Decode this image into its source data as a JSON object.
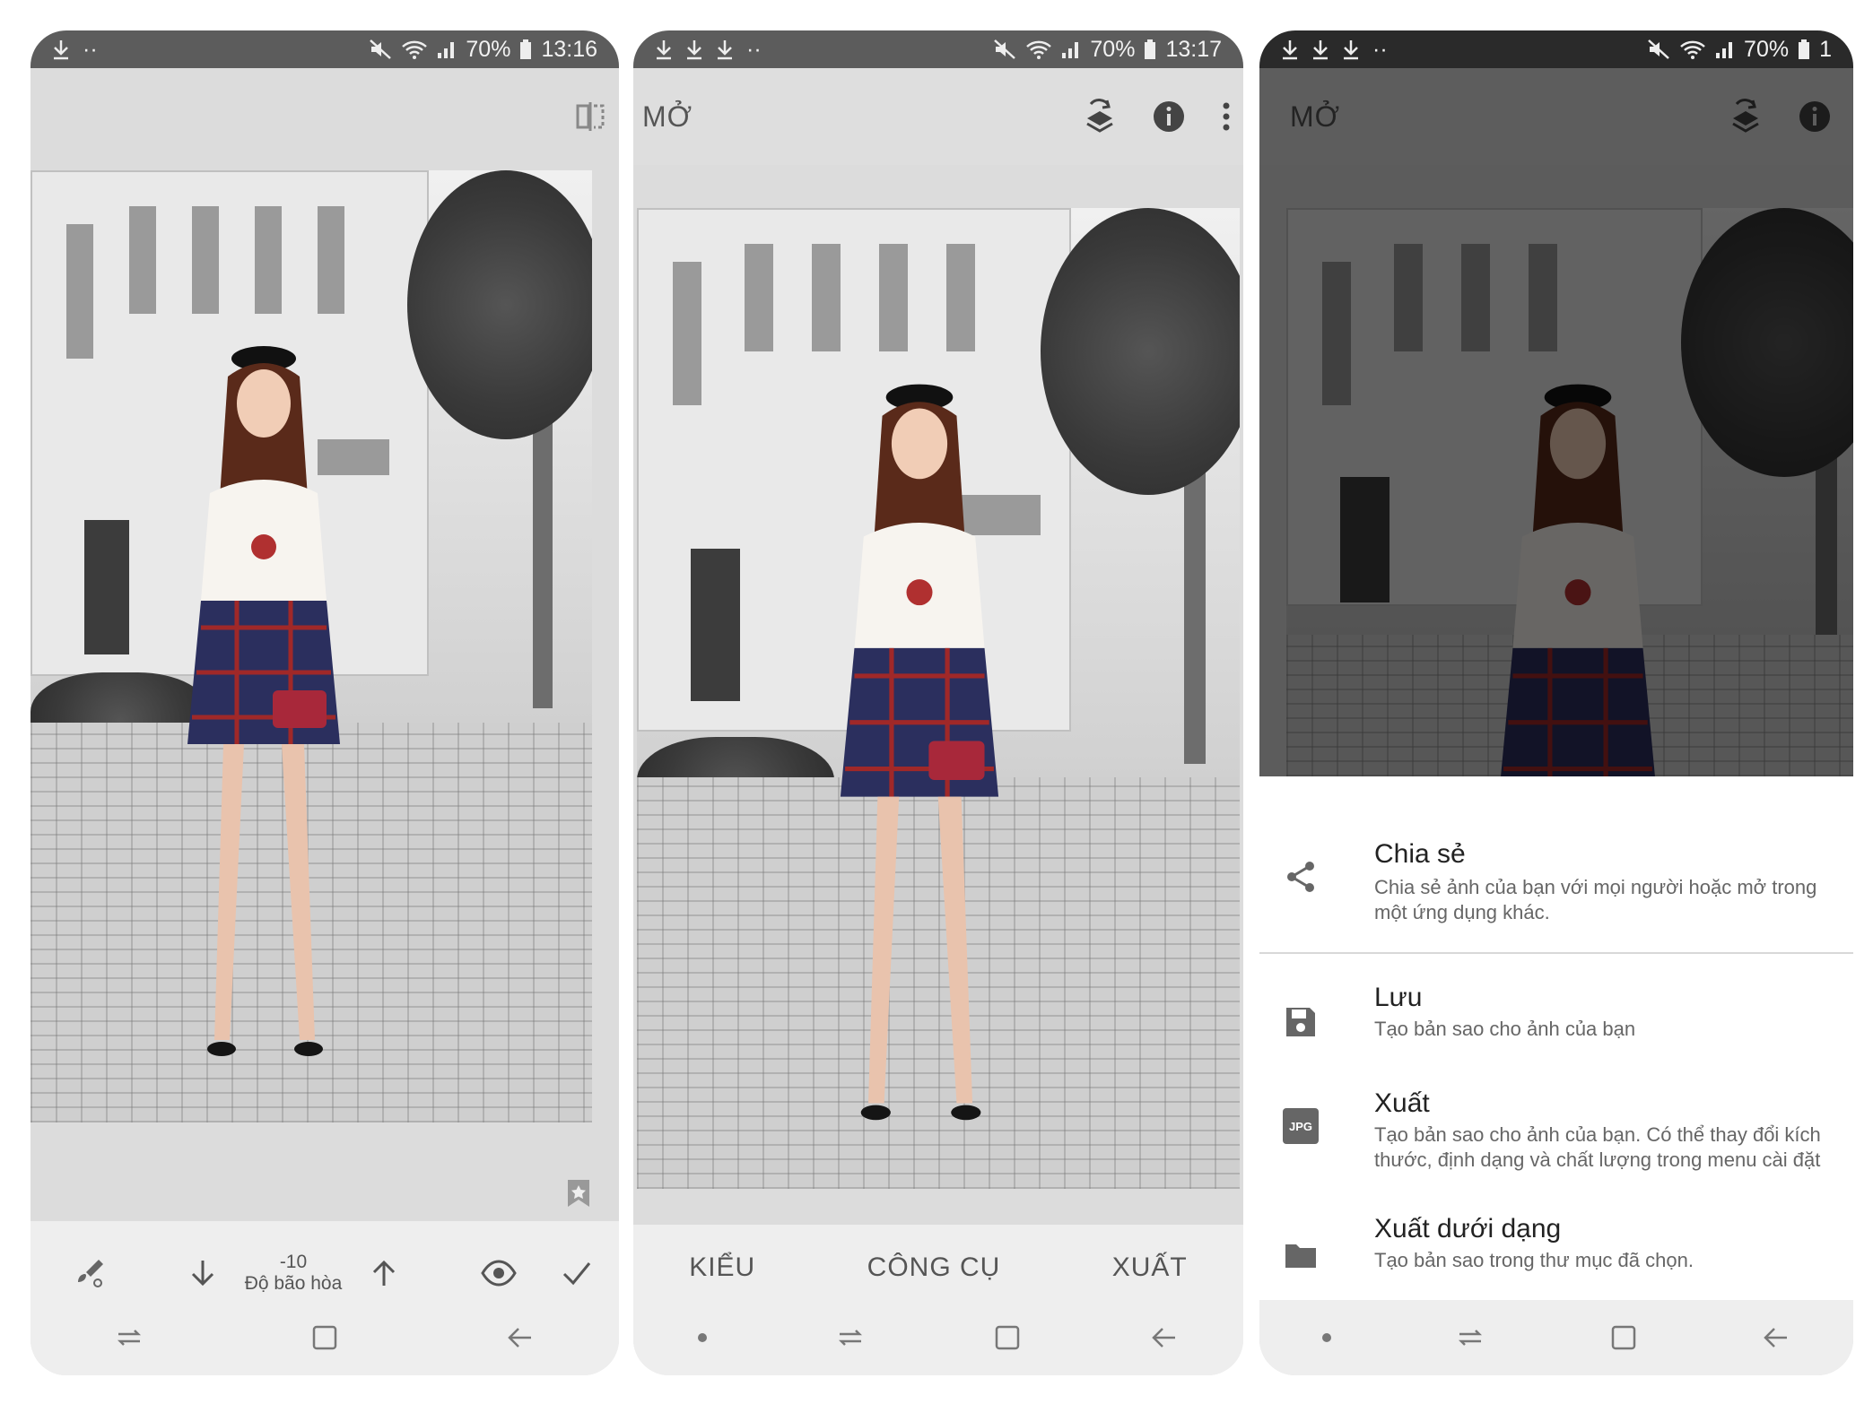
{
  "screens": [
    {
      "status": {
        "time": "13:16",
        "battery": "70%"
      },
      "tool": {
        "value": "-10",
        "name": "Độ bão hòa"
      }
    },
    {
      "status": {
        "time": "13:17",
        "battery": "70%"
      },
      "title": "MỞ",
      "tabs": [
        "KIỂU",
        "CÔNG CỤ",
        "XUẤT"
      ]
    },
    {
      "status": {
        "time": "1",
        "battery": "70%"
      },
      "title": "MỞ",
      "sheet": [
        {
          "title": "Chia sẻ",
          "desc": "Chia sẻ ảnh của bạn với mọi người hoặc mở trong một ứng dụng khác.",
          "icon": "share-icon"
        },
        {
          "title": "Lưu",
          "desc": "Tạo bản sao cho ảnh của bạn",
          "icon": "save-icon"
        },
        {
          "title": "Xuất",
          "desc": "Tạo bản sao cho ảnh của bạn. Có thể thay đổi kích thước, định dạng và chất lượng trong menu cài đặt",
          "icon": "jpg-icon",
          "badge": "JPG"
        },
        {
          "title": "Xuất dưới dạng",
          "desc": "Tạo bản sao trong thư mục đã chọn.",
          "icon": "folder-icon"
        }
      ]
    }
  ]
}
